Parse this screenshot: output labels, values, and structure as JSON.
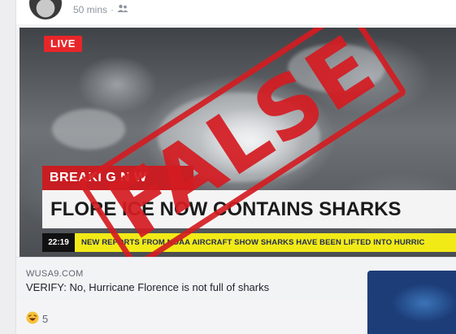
{
  "post": {
    "time": "50 mins",
    "separator": "·",
    "audience_icon": "friends-icon"
  },
  "video": {
    "live_label": "LIVE",
    "breaking_label": "BREAKI G N W",
    "headline": "FLORE ICE NOW CONTAINS SHARKS",
    "ticker_time": "22:19",
    "ticker_text": "NEW REPORTS FROM NOAA AIRCRAFT SHOW SHARKS HAVE BEEN LIFTED INTO HURRIC",
    "stamp_text": "FALSE",
    "stamp_color": "#d31c22"
  },
  "link": {
    "domain": "WUSA9.COM",
    "title": "VERIFY: No, Hurricane Florence is not full of sharks"
  },
  "reactions": {
    "icon": "haha-emoji-icon",
    "count": "5"
  }
}
